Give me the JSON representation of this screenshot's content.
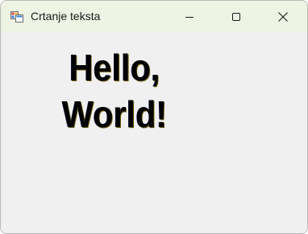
{
  "window": {
    "title": "Crtanje teksta",
    "app_icon": "windows-forms-app-icon",
    "controls": {
      "minimize_icon": "minimize-icon",
      "maximize_icon": "maximize-icon",
      "close_icon": "close-icon"
    }
  },
  "client": {
    "lines": [
      "Hello,",
      "World!"
    ],
    "text_color": "#000000",
    "background_color": "#f0f0f0"
  },
  "colors": {
    "titlebar": "#eef3e3",
    "window_border": "#b9b9b9"
  }
}
